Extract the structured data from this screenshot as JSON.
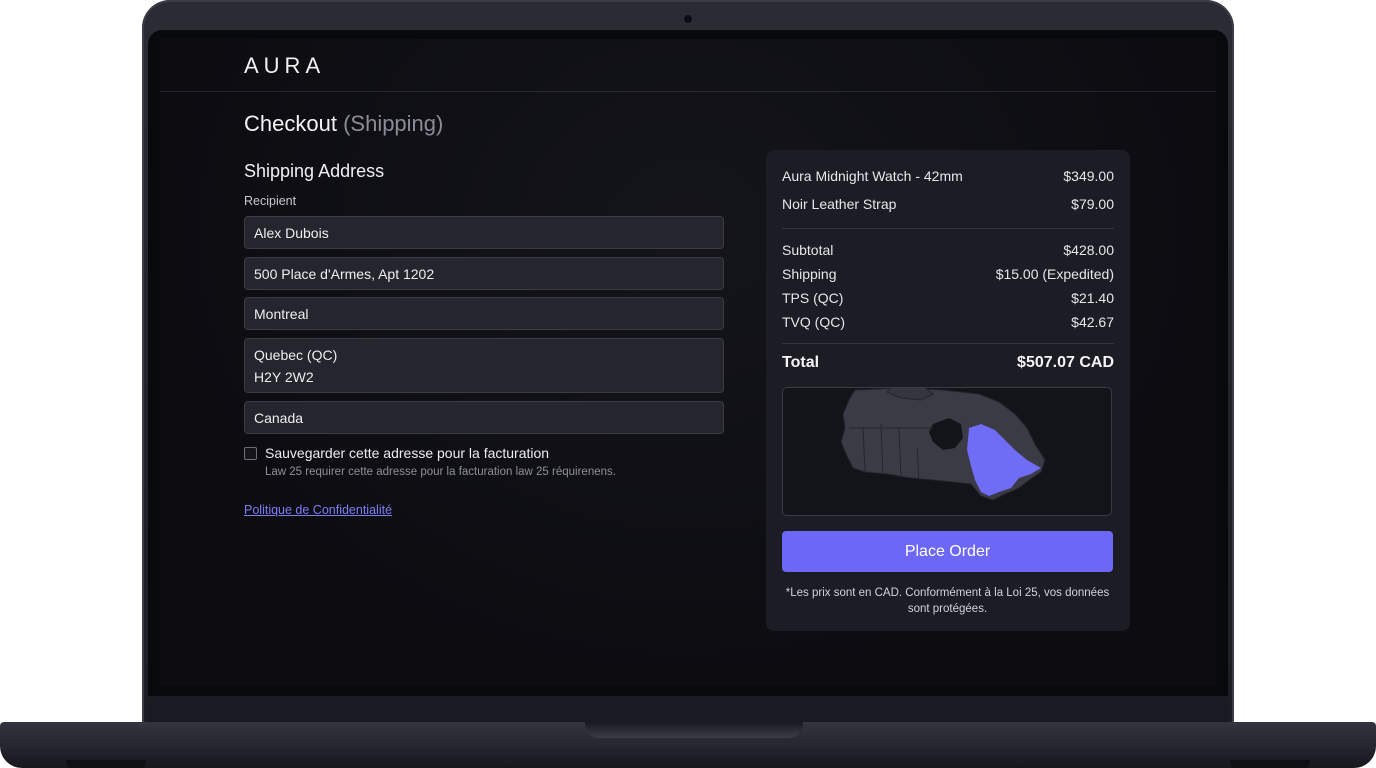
{
  "brand": {
    "logo_text": "AURA"
  },
  "page": {
    "title": "Checkout",
    "title_step": "(Shipping)"
  },
  "shipping": {
    "section_title": "Shipping Address",
    "recipient_label": "Recipient",
    "recipient_name": "Alex Dubois",
    "street": "500 Place d'Armes, Apt 1202",
    "city": "Montreal",
    "province": "Quebec (QC)",
    "postal_code": "H2Y 2W2",
    "country": "Canada",
    "save_billing_label": "Sauvegarder cette adresse pour la facturation",
    "save_billing_hint": "Law 25 requirer cette adresse pour la facturation law 25 réquirenens.",
    "save_billing_checked": false,
    "privacy_link": "Politique de Confidentialité"
  },
  "summary": {
    "items": [
      {
        "name": "Aura Midnight Watch - 42mm",
        "price": "$349.00"
      },
      {
        "name": "Noir Leather Strap",
        "price": "$79.00"
      }
    ],
    "subtotal_label": "Subtotal",
    "subtotal_value": "$428.00",
    "shipping_label": "Shipping",
    "shipping_value": "$15.00 (Expedited)",
    "tps_label": "TPS (QC)",
    "tps_value": "$21.40",
    "tvq_label": "TVQ (QC)",
    "tvq_value": "$42.67",
    "total_label": "Total",
    "total_value": "$507.07 CAD",
    "place_order_label": "Place Order",
    "disclaimer": "*Les prix sont en CAD. Conformément à la Loi 25, vos données sont protégées."
  },
  "colors": {
    "accent": "#6c67f5",
    "map_highlight": "#6f6cf6",
    "background": "#0c0c11",
    "card": "#1c1d24"
  }
}
